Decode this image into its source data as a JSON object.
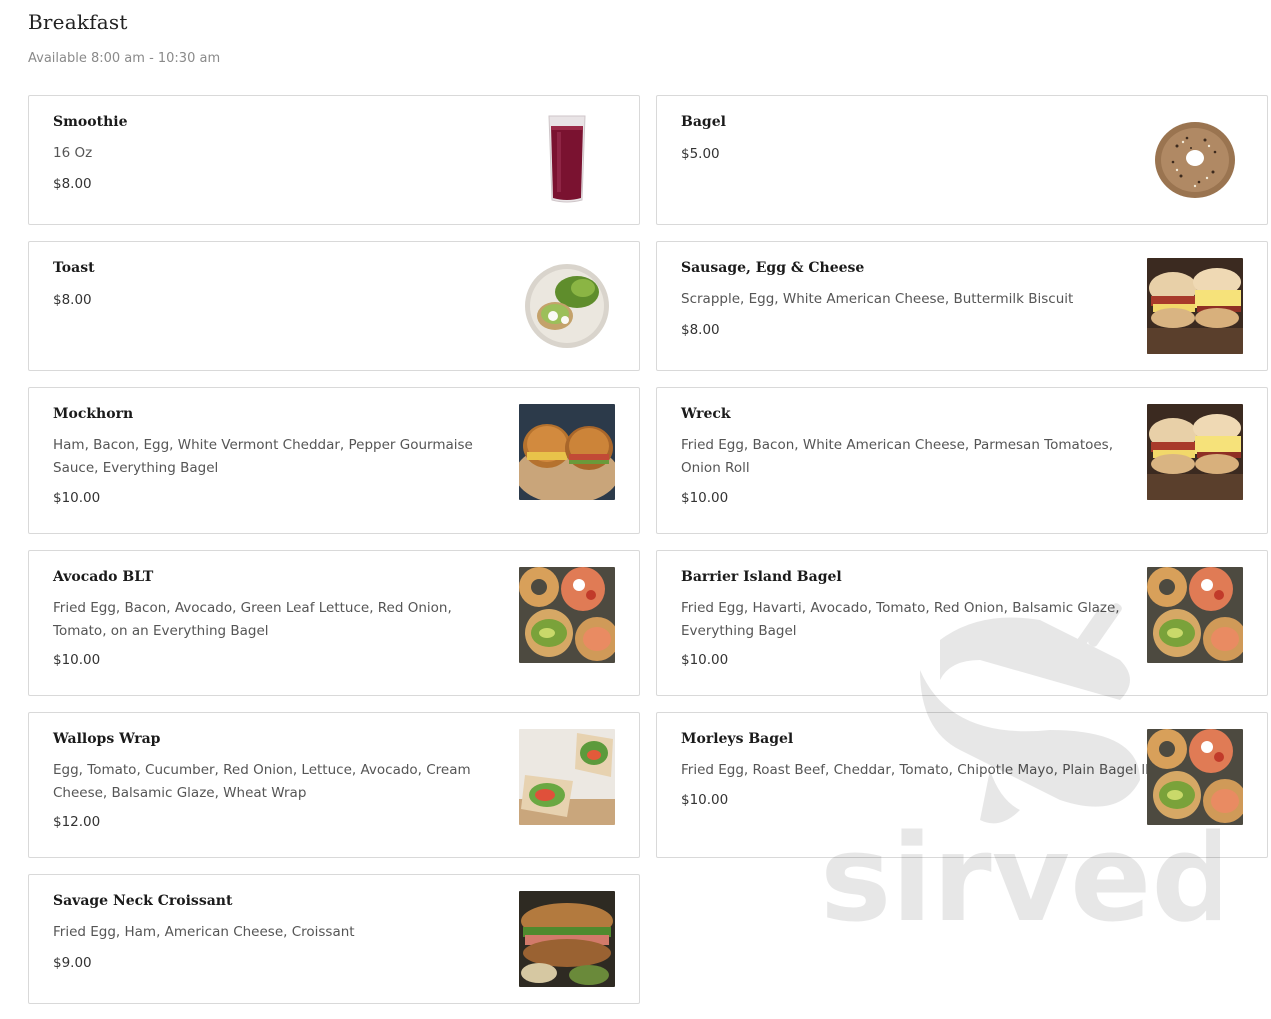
{
  "section": {
    "title": "Breakfast",
    "availability": "Available 8:00 am - 10:30 am"
  },
  "items": [
    {
      "name": "Smoothie",
      "description": "16 Oz",
      "price": "$8.00",
      "image_icon": "smoothie-glass-icon"
    },
    {
      "name": "Bagel",
      "description": "",
      "price": "$5.00",
      "image_icon": "bagel-icon"
    },
    {
      "name": "Toast",
      "description": "",
      "price": "$8.00",
      "image_icon": "avocado-toast-plate-icon"
    },
    {
      "name": "Sausage, Egg & Cheese",
      "description": "Scrapple, Egg, White American Cheese, Buttermilk Biscuit",
      "price": "$8.00",
      "image_icon": "biscuit-sandwich-photo"
    },
    {
      "name": "Mockhorn",
      "description": "Ham, Bacon, Egg, White Vermont Cheddar, Pepper Gourmaise Sauce, Everything Bagel",
      "price": "$10.00",
      "image_icon": "bagel-sandwich-photo"
    },
    {
      "name": "Wreck",
      "description": "Fried Egg, Bacon, White American Cheese, Parmesan Tomatoes, Onion Roll",
      "price": "$10.00",
      "image_icon": "biscuit-sandwich-photo"
    },
    {
      "name": "Avocado BLT",
      "description": "Fried Egg, Bacon, Avocado, Green Leaf Lettuce, Red Onion, Tomato, on an Everything Bagel",
      "price": "$10.00",
      "image_icon": "avocado-bagel-photo"
    },
    {
      "name": "Barrier Island Bagel",
      "description": "Fried Egg, Havarti, Avocado, Tomato, Red Onion, Balsamic Glaze, Everything Bagel",
      "price": "$10.00",
      "image_icon": "avocado-bagel-photo"
    },
    {
      "name": "Wallops Wrap",
      "description": "Egg, Tomato, Cucumber, Red Onion, Lettuce, Avocado, Cream Cheese, Balsamic Glaze, Wheat Wrap",
      "price": "$12.00",
      "image_icon": "wrap-photo"
    },
    {
      "name": "Morleys Bagel",
      "description": "Fried Egg, Roast Beef, Cheddar, Tomato, Chipotle Mayo, Plain Bagel ll",
      "price": "$10.00",
      "image_icon": "avocado-bagel-photo"
    },
    {
      "name": "Savage Neck Croissant",
      "description": "Fried Egg, Ham, American Cheese, Croissant",
      "price": "$9.00",
      "image_icon": "croissant-sandwich-photo"
    }
  ],
  "watermark": {
    "text": "sirved"
  },
  "colors": {
    "border": "#d9d9d9",
    "muted_text": "#8a8a8a",
    "body_text": "#555555"
  }
}
